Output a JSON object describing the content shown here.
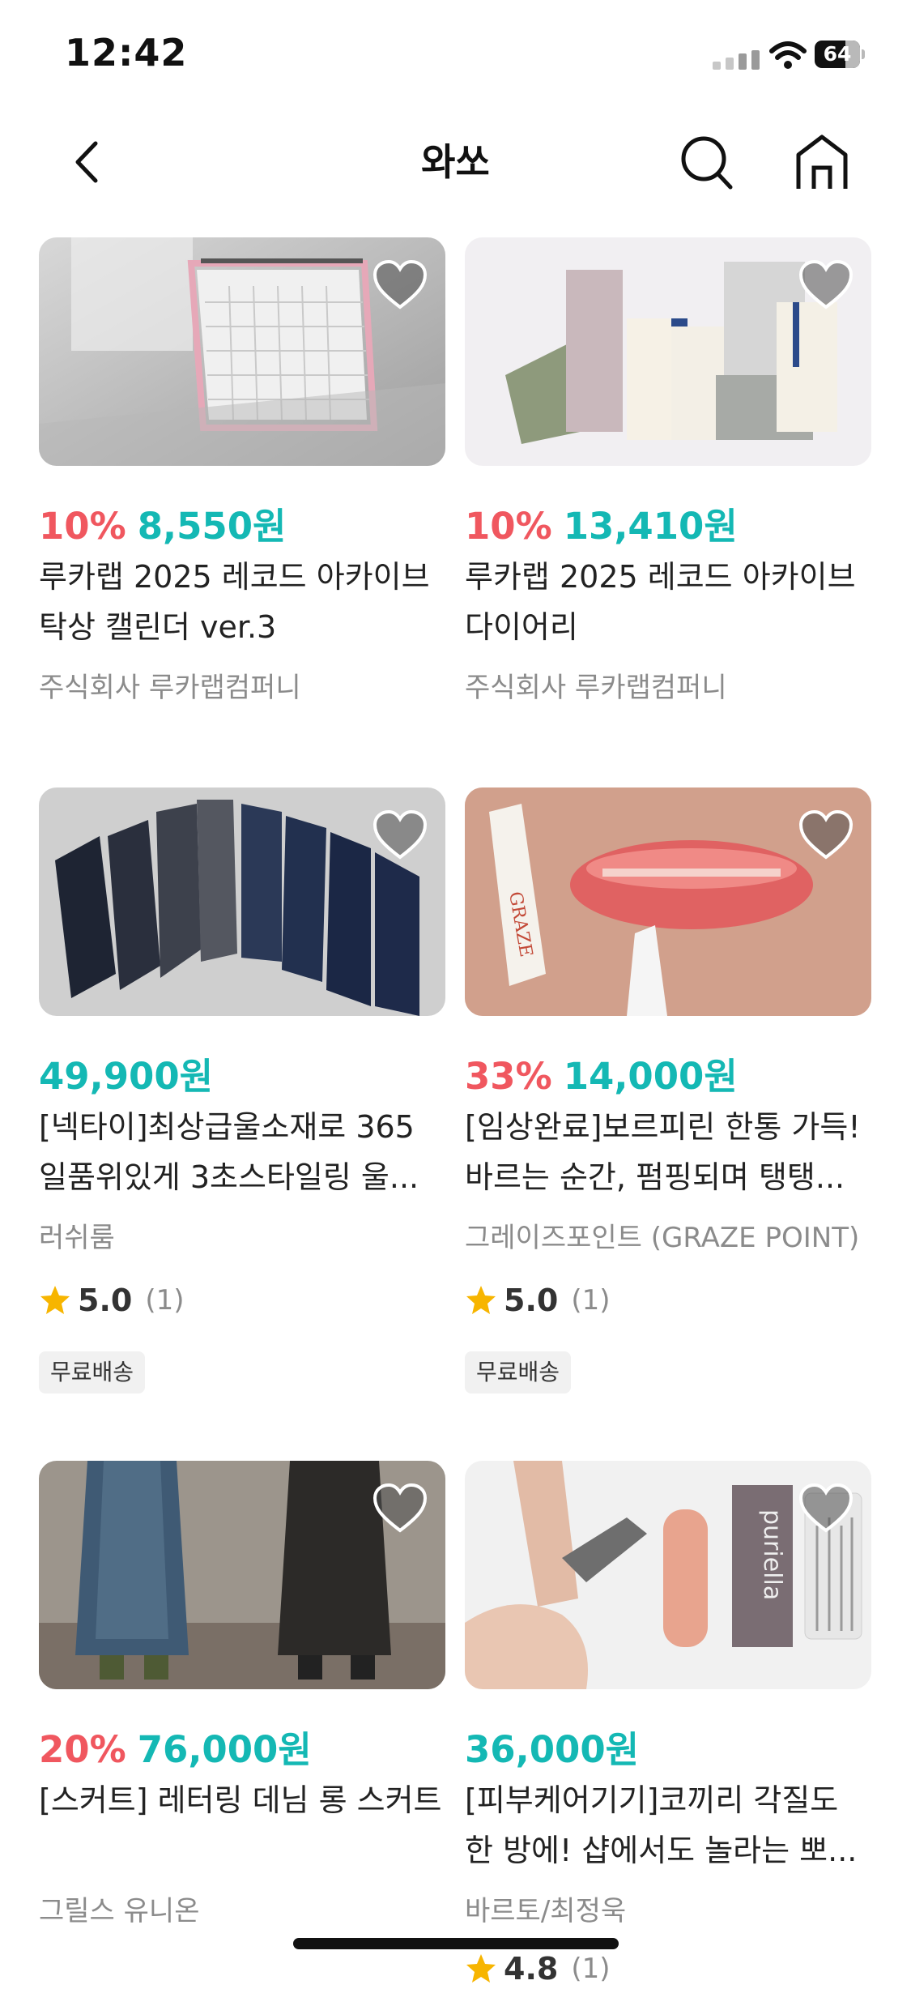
{
  "status_bar": {
    "time": "12:42",
    "battery_level": "64",
    "icons": [
      "signal-icon",
      "wifi-icon",
      "battery-icon"
    ]
  },
  "header": {
    "title": "와쏘",
    "icons": [
      "back-arrow-icon",
      "search-icon",
      "home-icon"
    ]
  },
  "colors": {
    "discount": "#f0575f",
    "price": "#14b8b4",
    "star": "#f7b500",
    "badge_bg": "#f1f1f1"
  },
  "products": [
    {
      "discount": "10%",
      "price": "8,550원",
      "title": "루카랩 2025 레코드 아카이브 탁상 캘린더 ver.3",
      "seller": "주식회사 루카랩컴퍼니",
      "image": "pink desk calendar"
    },
    {
      "discount": "10%",
      "price": "13,410원",
      "title": "루카랩 2025 레코드 아카이브 다이어리",
      "seller": "주식회사 루카랩컴퍼니",
      "image": "diaries set"
    },
    {
      "price": "49,900원",
      "title": "[넥타이]최상급울소재로 365 일품위있게 3초스타일링 울...",
      "seller": "러쉬룸",
      "rating": "5.0",
      "rating_count": "(1)",
      "badge": "무료배송",
      "image": "neckties"
    },
    {
      "discount": "33%",
      "price": "14,000원",
      "title": "[임상완료]보르피린 한통 가득! 바르는 순간, 펌핑되며 탱탱...",
      "seller": "그레이즈포인트 (GRAZE POINT)",
      "rating": "5.0",
      "rating_count": "(1)",
      "badge": "무료배송",
      "image": "lip plumper",
      "image_text": "GRAZE"
    },
    {
      "discount": "20%",
      "price": "76,000원",
      "title": "[스커트] 레터링 데님 롱 스커트",
      "seller": "그릴스 유니온",
      "image": "denim skirts"
    },
    {
      "price": "36,000원",
      "title": "[피부케어기기]코끼리 각질도 한 방에! 샵에서도 놀라는 뽀...",
      "seller": "바르토/최정욱",
      "rating": "4.8",
      "rating_count": "(1)",
      "image": "foot file device",
      "image_text": "puriella"
    }
  ]
}
